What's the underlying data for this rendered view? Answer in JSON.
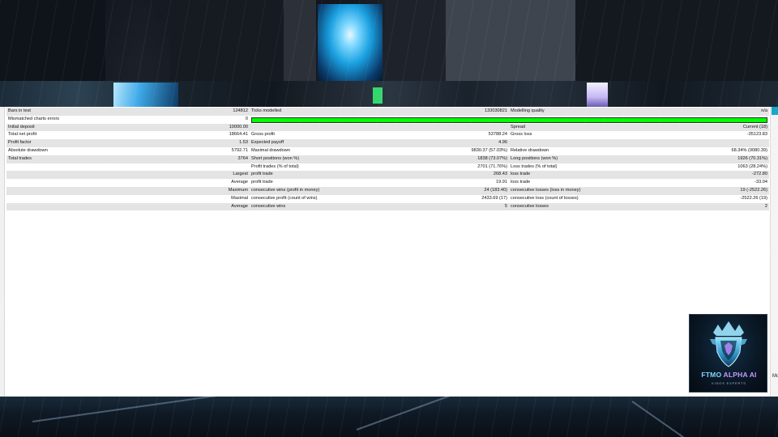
{
  "report": {
    "rows": [
      [
        "Bars in test",
        "124812",
        "Ticks modelled",
        "133030821",
        "Modelling quality",
        "n/a"
      ],
      [
        "Mismatched charts errors",
        "0",
        "",
        "",
        "",
        ""
      ],
      [
        "Initial deposit",
        "10000.00",
        "",
        "",
        "Spread",
        "Current (18)"
      ],
      [
        "Total net profit",
        "18664.41",
        "Gross profit",
        "53788.24",
        "Gross loss",
        "-35123.83"
      ],
      [
        "Profit factor",
        "1.53",
        "Expected payoff",
        "4.96",
        "",
        ""
      ],
      [
        "Absolute drawdown",
        "5792.71",
        "Maximal drawdown",
        "9830.37 (57.03%)",
        "Relative drawdown",
        "68.34% (9080.39)"
      ],
      [
        "Total trades",
        "3764",
        "Short positions (won %)",
        "1838 (73.07%)",
        "Long positions (won %)",
        "1926 (70.31%)"
      ],
      [
        "",
        "",
        "Profit trades (% of total)",
        "2701 (71.76%)",
        "Loss trades (% of total)",
        "1063 (28.24%)"
      ],
      [
        "",
        "Largest",
        "profit trade",
        "268.43",
        "loss trade",
        "-272.80"
      ],
      [
        "",
        "Average",
        "profit trade",
        "19.91",
        "loss trade",
        "-33.04"
      ],
      [
        "",
        "Maximum",
        "consecutive wins (profit in money)",
        "24 (183.40)",
        "consecutive losses (loss in money)",
        "19 (-2522.26)"
      ],
      [
        "",
        "Maximal",
        "consecutive profit (count of wins)",
        "2433.69 (17)",
        "consecutive loss (count of losses)",
        "-2522.26 (19)"
      ],
      [
        "",
        "Average",
        "consecutive wins",
        "5",
        "consecutive losses",
        "2"
      ]
    ],
    "modelling_quality_bar": {
      "color": "#00ff00"
    }
  },
  "logo": {
    "brand": "FTMO",
    "brand_accent": "ALPHA AI",
    "tagline": "KIDOS EXPERTS"
  },
  "side_label": "Mo",
  "icons": [
    "crown-shield-icon"
  ]
}
